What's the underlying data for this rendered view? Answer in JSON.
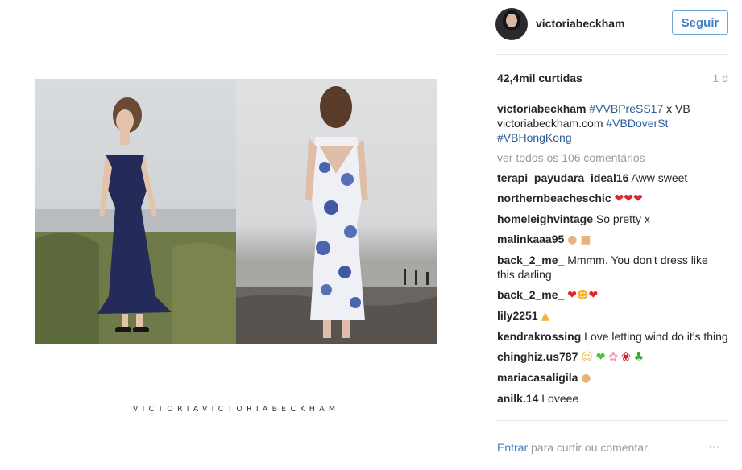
{
  "post": {
    "brand_caption": "VICTORIAVICTORIABECKHAM"
  },
  "header": {
    "username": "victoriabeckham",
    "follow_label": "Seguir"
  },
  "stats": {
    "likes": "42,4mil curtidas",
    "time_ago": "1 d"
  },
  "caption": {
    "user": "victoriabeckham",
    "hashtag_1": "#VVBPreSS17",
    "text_1": " x VB victoriabeckham.com ",
    "hashtag_2": "#VBDoverSt",
    "hashtag_3": "#VBHongKong"
  },
  "view_all_comments": "ver todos os 106 comentários",
  "comments": [
    {
      "user": "terapi_payudara_ideal16",
      "text": "Aww sweet"
    },
    {
      "user": "northernbeacheschic",
      "text": ""
    },
    {
      "user": "homeleighvintage",
      "text": "So pretty x"
    },
    {
      "user": "malinkaaa95",
      "text": ""
    },
    {
      "user": "back_2_me_",
      "text": "Mmmm. You don't dress like this darling"
    },
    {
      "user": "back_2_me_",
      "text": ""
    },
    {
      "user": "lily2251",
      "text": ""
    },
    {
      "user": "kendrakrossing",
      "text": "Love letting wind do it's thing"
    },
    {
      "user": "chinghiz.us787",
      "text": ""
    },
    {
      "user": "mariacasaligila",
      "text": ""
    },
    {
      "user": "anilk.14",
      "text": "Loveee"
    }
  ],
  "footer": {
    "login_label": "Entrar",
    "login_suffix": " para curtir ou comentar.",
    "more_options": "◦◦◦"
  },
  "icons": {
    "avatar": "profile-avatar",
    "more": "ellipsis-icon"
  },
  "colors": {
    "link_blue": "#3f80c5",
    "hashtag_blue": "#2f5e96",
    "muted_gray": "#9a9a9a",
    "divider": "#e6e6e6"
  }
}
